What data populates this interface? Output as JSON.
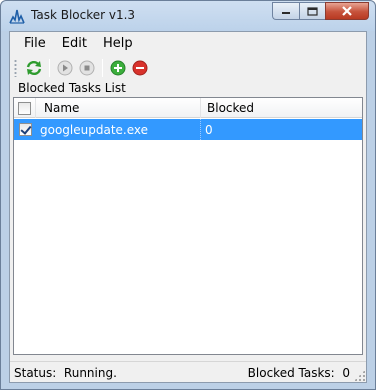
{
  "window": {
    "title": "Task Blocker v1.3",
    "buttons": {
      "minimize": "minimize-icon",
      "maximize": "maximize-icon",
      "close": "close-icon"
    }
  },
  "menu": {
    "items": [
      "File",
      "Edit",
      "Help"
    ]
  },
  "toolbar": {
    "buttons": [
      {
        "icon": "refresh-icon",
        "enabled": true
      },
      {
        "icon": "play-icon",
        "enabled": false
      },
      {
        "icon": "stop-icon",
        "enabled": false
      },
      {
        "icon": "add-icon",
        "enabled": true
      },
      {
        "icon": "remove-icon",
        "enabled": true
      }
    ]
  },
  "group_label": "Blocked Tasks List",
  "table": {
    "columns": [
      "Name",
      "Blocked"
    ],
    "rows": [
      {
        "checked": true,
        "name": "googleupdate.exe",
        "blocked": "0",
        "selected": true
      }
    ]
  },
  "status": {
    "label": "Status:",
    "value": "Running.",
    "blocked_label": "Blocked Tasks:",
    "blocked_value": "0"
  },
  "colors": {
    "selection": "#3399ff",
    "add": "#3cae3c",
    "remove": "#d8322c",
    "refresh": "#2e9b2e"
  }
}
